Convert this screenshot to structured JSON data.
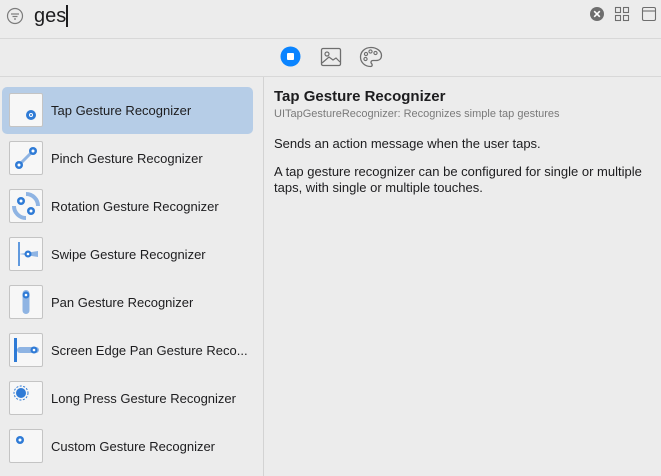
{
  "search": {
    "value": "ges",
    "placeholder": ""
  },
  "toolbar": {
    "filter_icon": "filter-icon",
    "clear_icon": "clear-icon",
    "grid_icon": "grid-view-icon",
    "window_icon": "window-icon"
  },
  "segments": {
    "selected": "objects",
    "items": [
      "objects-icon",
      "media-icon",
      "colors-icon"
    ],
    "accent": "#0a84ff"
  },
  "list": {
    "items": [
      {
        "label": "Tap Gesture Recognizer",
        "icon": "tap-gesture-icon",
        "selected": true
      },
      {
        "label": "Pinch Gesture Recognizer",
        "icon": "pinch-gesture-icon",
        "selected": false
      },
      {
        "label": "Rotation Gesture Recognizer",
        "icon": "rotation-gesture-icon",
        "selected": false
      },
      {
        "label": "Swipe Gesture Recognizer",
        "icon": "swipe-gesture-icon",
        "selected": false
      },
      {
        "label": "Pan Gesture Recognizer",
        "icon": "pan-gesture-icon",
        "selected": false
      },
      {
        "label": "Screen Edge Pan Gesture Reco...",
        "icon": "screen-edge-pan-gesture-icon",
        "selected": false
      },
      {
        "label": "Long Press Gesture Recognizer",
        "icon": "long-press-gesture-icon",
        "selected": false
      },
      {
        "label": "Custom Gesture Recognizer",
        "icon": "custom-gesture-icon",
        "selected": false
      }
    ]
  },
  "detail": {
    "title": "Tap Gesture Recognizer",
    "subtitle": "UITapGestureRecognizer: Recognizes simple tap gestures",
    "summary": "Sends an action message when the user taps.",
    "body": "A tap gesture recognizer can be configured for single or multiple taps, with single or multiple touches."
  },
  "colors": {
    "selection": "#b6cde7",
    "touch_blue": "#2f7bd6",
    "background": "#ececec"
  }
}
